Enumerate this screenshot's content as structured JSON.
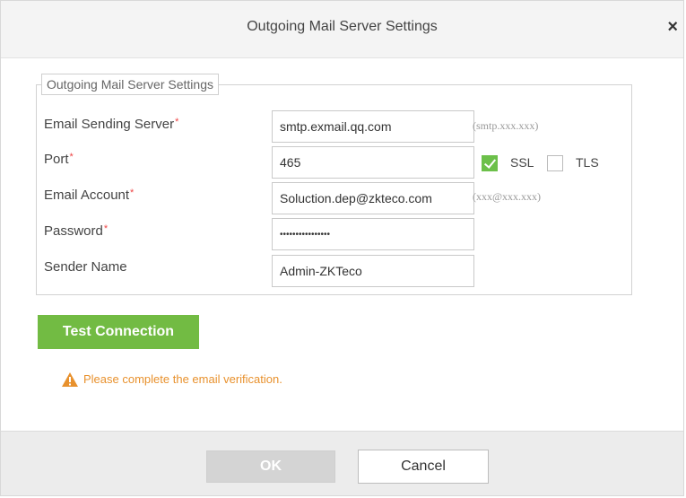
{
  "dialog": {
    "title": "Outgoing Mail Server Settings",
    "close_icon": "close-icon",
    "close_glyph": "×"
  },
  "group": {
    "legend": "Outgoing Mail Server Settings"
  },
  "fields": {
    "server": {
      "label": "Email Sending Server",
      "required": "*",
      "value": "smtp.exmail.qq.com",
      "hint": "(smtp.xxx.xxx)"
    },
    "port": {
      "label": "Port",
      "required": "*",
      "value": "465"
    },
    "account": {
      "label": "Email Account",
      "required": "*",
      "value": "Soluction.dep@zkteco.com",
      "hint": "(xxx@xxx.xxx)"
    },
    "password": {
      "label": "Password",
      "required": "*",
      "value": "••••••••••••••••"
    },
    "sender": {
      "label": "Sender Name",
      "value": "Admin-ZKTeco"
    }
  },
  "security": {
    "ssl": {
      "label": "SSL",
      "checked": true
    },
    "tls": {
      "label": "TLS",
      "checked": false
    }
  },
  "test_button": "Test Connection",
  "warning": {
    "icon": "warning-icon",
    "text": "Please complete the email verification."
  },
  "footer": {
    "ok": "OK",
    "cancel": "Cancel"
  },
  "colors": {
    "accent": "#72bb43",
    "warning": "#e8912d",
    "required": "#ee4444",
    "disabled": "#d4d4d4"
  }
}
